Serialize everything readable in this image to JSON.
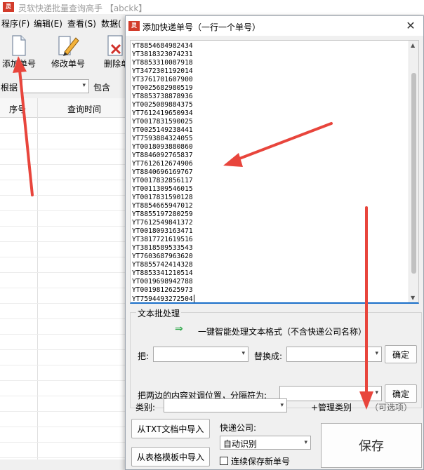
{
  "main_window": {
    "title": "灵软快递批量查询高手 【abckk】",
    "menu": [
      "程序(F)",
      "编辑(E)",
      "查看(S)",
      "数据("
    ],
    "toolbar": [
      {
        "label": "添加单号",
        "icon": "document-icon"
      },
      {
        "label": "修改单号",
        "icon": "pencil-icon"
      },
      {
        "label": "删除单",
        "icon": "delete-icon"
      }
    ],
    "filter": {
      "label": "根据",
      "mode": "包含"
    },
    "grid_headers": [
      "序号",
      "查询时间"
    ]
  },
  "dialog": {
    "title": "添加快递单号（一行一个单号）",
    "close_label": "✕",
    "tracking_numbers": [
      "YT8854684982434",
      "YT3818323074231",
      "YT8853310087918",
      "YT3472301192014",
      "YT3761701607900",
      "YT0025682980519",
      "YT8853738878936",
      "YT0025089884375",
      "YT7612419650934",
      "YT0017831590025",
      "YT0025149238441",
      "YT7593884324055",
      "YT0018093880860",
      "YT8846092765837",
      "YT7612612674906",
      "YT8840696169767",
      "YT0017832856117",
      "YT0011309546015",
      "YT0017831590128",
      "YT8854665947012",
      "YT8855197280259",
      "YT7612549841372",
      "YT0018093163471",
      "YT3817721619516",
      "YT3818589533543",
      "YT7603687963620",
      "YT8855742414328",
      "YT8853341210514",
      "YT0019698942788",
      "YT0019812625973",
      "YT7594493272504"
    ],
    "batch": {
      "legend": "文本批处理",
      "smart_text": "一键智能处理文本格式（不含快递公司名称）",
      "replace_from_label": "把:",
      "replace_to_label": "替换成:",
      "confirm_label": "确定",
      "swap_label": "把两边的内容对调位置，分隔符为:"
    },
    "category_label": "类别:",
    "manage_category": "+管理类别",
    "optional_hint": "（可选项）",
    "import_txt": "从TXT文档中导入",
    "import_template": "从表格模板中导入",
    "courier_label": "快递公司:",
    "courier_value": "自动识别",
    "continuous_save": "连续保存新单号",
    "save": "保存"
  },
  "colors": {
    "annotation_arrow": "#e8453c",
    "focus_border": "#1a6fc9",
    "smart_arrow": "#2fa84a"
  }
}
